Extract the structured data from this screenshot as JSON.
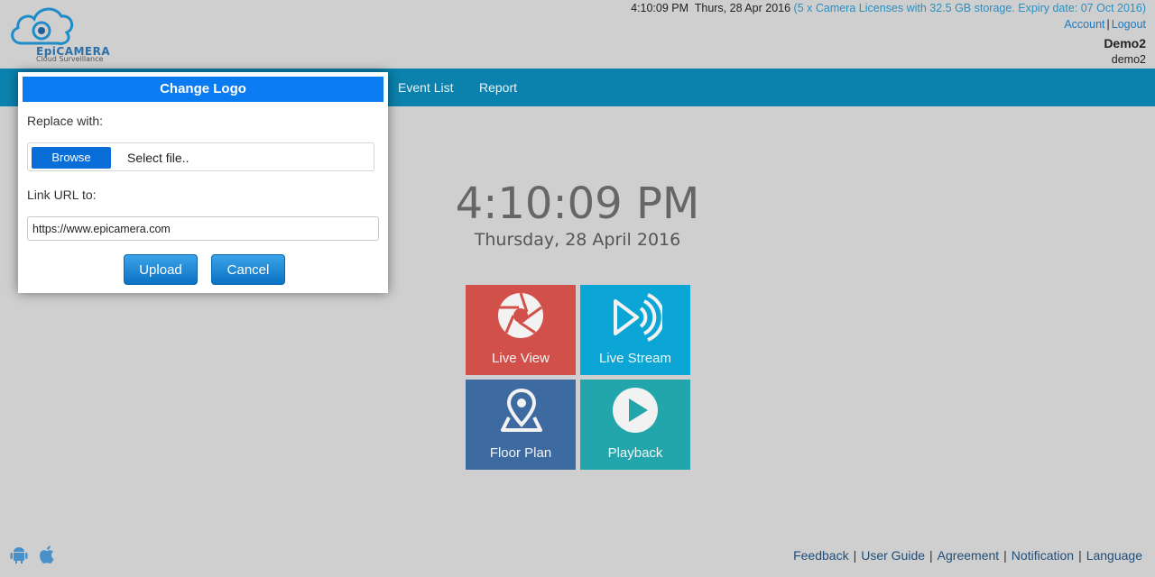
{
  "header": {
    "logo_text": "EpiCAMERA",
    "logo_sub": "Cloud Surveillance",
    "datetime": "4:10:09 PM  Thurs, 28 Apr 2016",
    "license": "(5 x Camera Licenses with 32.5 GB storage. Expiry date: 07 Oct 2016)",
    "account_label": "Account",
    "logout_label": "Logout",
    "user_name": "Demo2",
    "user_id": "demo2"
  },
  "nav": {
    "items": [
      "Event List",
      "Report"
    ]
  },
  "clock": {
    "time": "4:10:09 PM",
    "date": "Thursday, 28 April 2016"
  },
  "tiles": [
    {
      "label": "Live View",
      "color": "#d2504a",
      "icon": "aperture-icon"
    },
    {
      "label": "Live Stream",
      "color": "#0ca6d6",
      "icon": "stream-icon"
    },
    {
      "label": "Floor Plan",
      "color": "#3c6aa1",
      "icon": "map-pin-icon"
    },
    {
      "label": "Playback",
      "color": "#22a6ab",
      "icon": "play-icon"
    }
  ],
  "footer": {
    "links": [
      "Feedback",
      "User Guide",
      "Agreement",
      "Notification",
      "Language"
    ],
    "icons": [
      "android-icon",
      "apple-icon"
    ]
  },
  "dialog": {
    "title": "Change Logo",
    "replace_label": "Replace with:",
    "browse_label": "Browse",
    "file_placeholder": "Select file..",
    "link_label": "Link URL to:",
    "link_value": "https://www.epicamera.com",
    "upload_label": "Upload",
    "cancel_label": "Cancel"
  },
  "colors": {
    "navbar": "#0a82ad",
    "dialog_title": "#0a7bf0",
    "background": "#cfcfcf"
  }
}
